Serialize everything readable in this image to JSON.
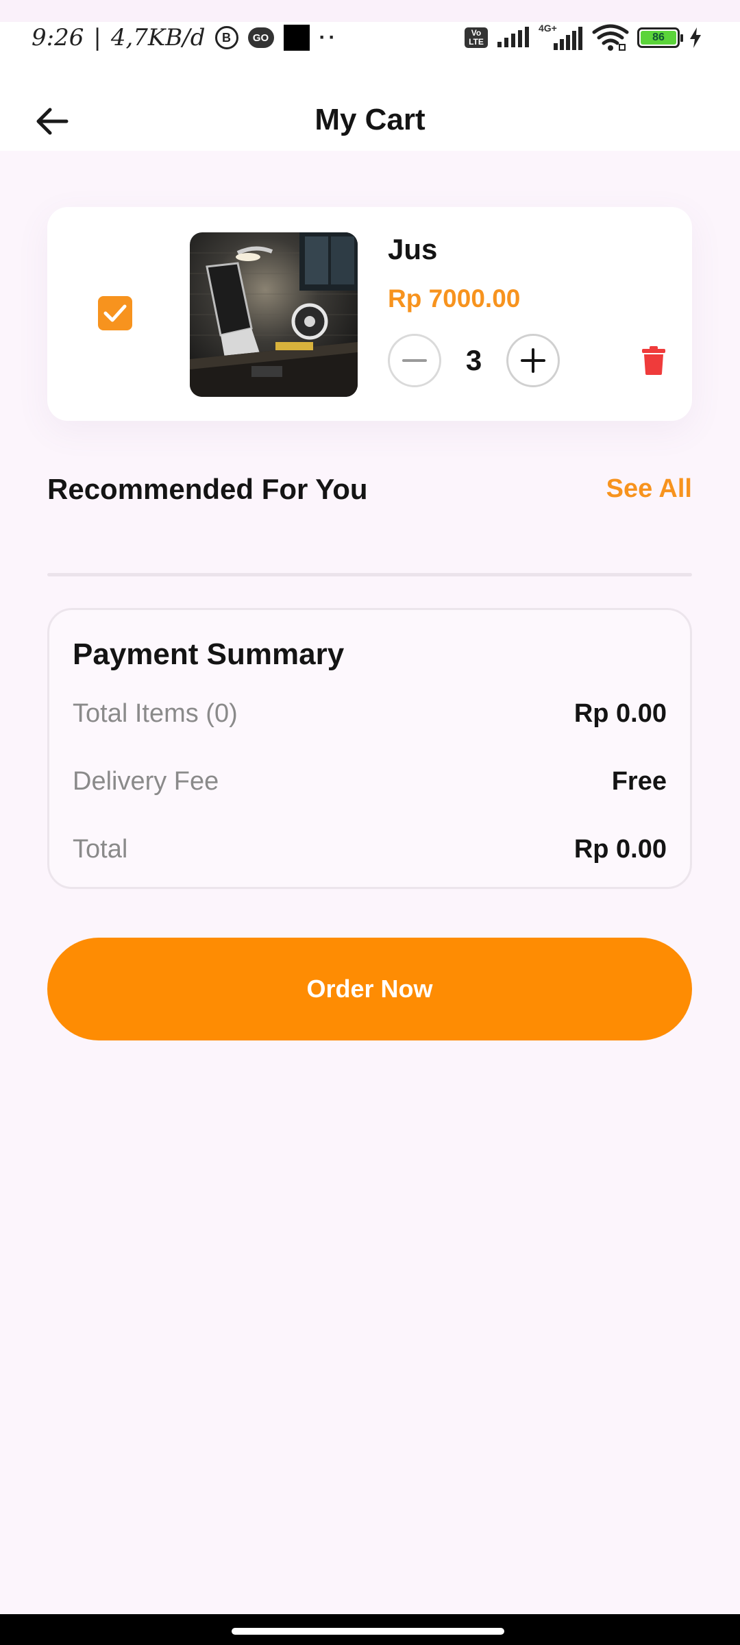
{
  "status_bar": {
    "time": "9:26",
    "separator": "|",
    "network_speed": "4,7KB/d",
    "badge_b": "B",
    "badge_go": "GO",
    "dots": "··",
    "volte_label": "Vo LTE",
    "network_type": "4G+",
    "battery_level": "86"
  },
  "header": {
    "title": "My Cart",
    "back_icon": "arrow-left-icon"
  },
  "cart": {
    "items": [
      {
        "checked": true,
        "image_icon": "laptop-desk-photo",
        "name": "Jus",
        "price": "Rp 7000.00",
        "quantity": "3"
      }
    ]
  },
  "recommended": {
    "title": "Recommended For You",
    "see_all_label": "See All"
  },
  "payment_summary": {
    "title": "Payment Summary",
    "rows": [
      {
        "label": "Total Items (0)",
        "value": "Rp 0.00"
      },
      {
        "label": "Delivery Fee",
        "value": "Free"
      },
      {
        "label": "Total",
        "value": "Rp 0.00"
      }
    ]
  },
  "order_button_label": "Order Now",
  "colors": {
    "accent": "#f7931e",
    "order_button": "#fe8c03",
    "delete": "#ef3b3b",
    "background": "#fcf5fc"
  }
}
